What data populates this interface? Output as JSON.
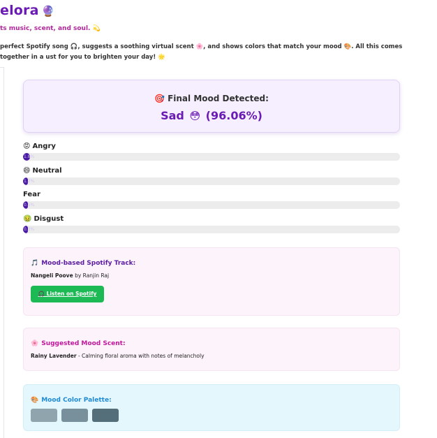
{
  "header": {
    "title": "elora",
    "title_icon": "🔮",
    "tagline": "ts music, scent, and soul. 💫",
    "description": "perfect Spotify song 🎧, suggests a soothing virtual scent 🌸, and shows colors that match your mood 🎨. All this comes together in a ust for you to brighten your day! 🌟"
  },
  "final": {
    "label": "Final Mood Detected:",
    "label_icon": "🎯",
    "mood": "Sad",
    "mood_icon": "😳",
    "confidence": "(96.06%)"
  },
  "emotions": [
    {
      "name": "Angry",
      "icon": "😡",
      "percent_text": "1.8%",
      "value": 1.8
    },
    {
      "name": "Neutral",
      "icon": "😄",
      "percent_text": "1.2%",
      "value": 1.2
    },
    {
      "name": "Fear",
      "icon": "",
      "percent_text": "0.5%",
      "value": 0.5
    },
    {
      "name": "Disgust",
      "icon": "🤢",
      "percent_text": "0.3%",
      "value": 0.3
    }
  ],
  "spotify": {
    "title": "Mood-based Spotify Track:",
    "title_icon": "🎵",
    "track": "Nangeli Poove",
    "by": "by Ranjin Raj",
    "button_label": "🎧 Listen on Spotify"
  },
  "scent": {
    "title": "Suggested Mood Scent:",
    "title_icon": "🌸",
    "name": "Rainy Lavender",
    "description": "- Calming floral aroma with notes of melancholy"
  },
  "palette": {
    "title": "Mood Color Palette:",
    "title_icon": "🎨",
    "colors": [
      "#90a4ae",
      "#78909c",
      "#546e7a"
    ]
  }
}
